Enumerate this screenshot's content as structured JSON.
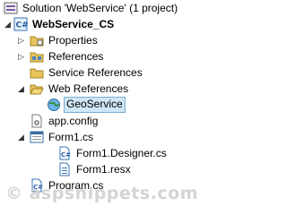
{
  "tree": {
    "solution": {
      "label": "Solution 'WebService' (1 project)",
      "icon": "solution-icon"
    },
    "project": {
      "label": "WebService_CS",
      "icon": "csharp-project-icon"
    },
    "properties": {
      "label": "Properties",
      "icon": "properties-folder-icon"
    },
    "references": {
      "label": "References",
      "icon": "references-folder-icon"
    },
    "service_references": {
      "label": "Service References",
      "icon": "folder-icon"
    },
    "web_references": {
      "label": "Web References",
      "icon": "open-folder-icon"
    },
    "geoservice": {
      "label": "GeoService",
      "icon": "web-service-globe-icon"
    },
    "app_config": {
      "label": "app.config",
      "icon": "config-file-icon"
    },
    "form1": {
      "label": "Form1.cs",
      "icon": "form-icon"
    },
    "form1_designer": {
      "label": "Form1.Designer.cs",
      "icon": "csharp-file-icon"
    },
    "form1_resx": {
      "label": "Form1.resx",
      "icon": "resx-file-icon"
    },
    "program": {
      "label": "Program.cs",
      "icon": "csharp-file-icon"
    }
  },
  "watermark": "© aspsnippets.com",
  "colors": {
    "selection_bg": "#cfe6f7",
    "selection_border": "#7daecf",
    "folder": "#e8c55a"
  }
}
